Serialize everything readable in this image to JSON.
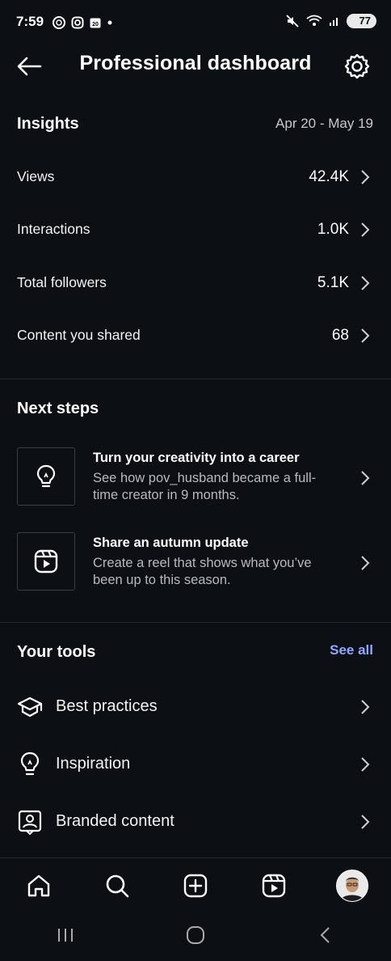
{
  "status": {
    "time": "7:59",
    "battery": "77"
  },
  "header": {
    "title": "Professional dashboard"
  },
  "insights": {
    "title": "Insights",
    "date_range": "Apr 20 - May 19",
    "metrics": [
      {
        "label": "Views",
        "value": "42.4K"
      },
      {
        "label": "Interactions",
        "value": "1.0K"
      },
      {
        "label": "Total followers",
        "value": "5.1K"
      },
      {
        "label": "Content you shared",
        "value": "68"
      }
    ]
  },
  "next_steps": {
    "title": "Next steps",
    "items": [
      {
        "title": "Turn your creativity into a career",
        "description": "See how pov_husband became a full-time creator in 9 months.",
        "icon": "lightbulb-icon"
      },
      {
        "title": "Share an autumn update",
        "description": "Create a reel that shows what you’ve been up to this season.",
        "icon": "reel-icon"
      }
    ]
  },
  "tools": {
    "title": "Your tools",
    "see_all": "See all",
    "items": [
      {
        "label": "Best practices",
        "icon": "graduation-cap-icon"
      },
      {
        "label": "Inspiration",
        "icon": "lightbulb-icon"
      },
      {
        "label": "Branded content",
        "icon": "branded-content-icon"
      }
    ]
  },
  "bottom_nav": [
    "home-icon",
    "search-icon",
    "create-icon",
    "reels-icon",
    "profile-avatar"
  ],
  "colors": {
    "background": "#0c0f14",
    "accent_link": "#8fa8ff",
    "secondary_text": "#b7b9be"
  }
}
